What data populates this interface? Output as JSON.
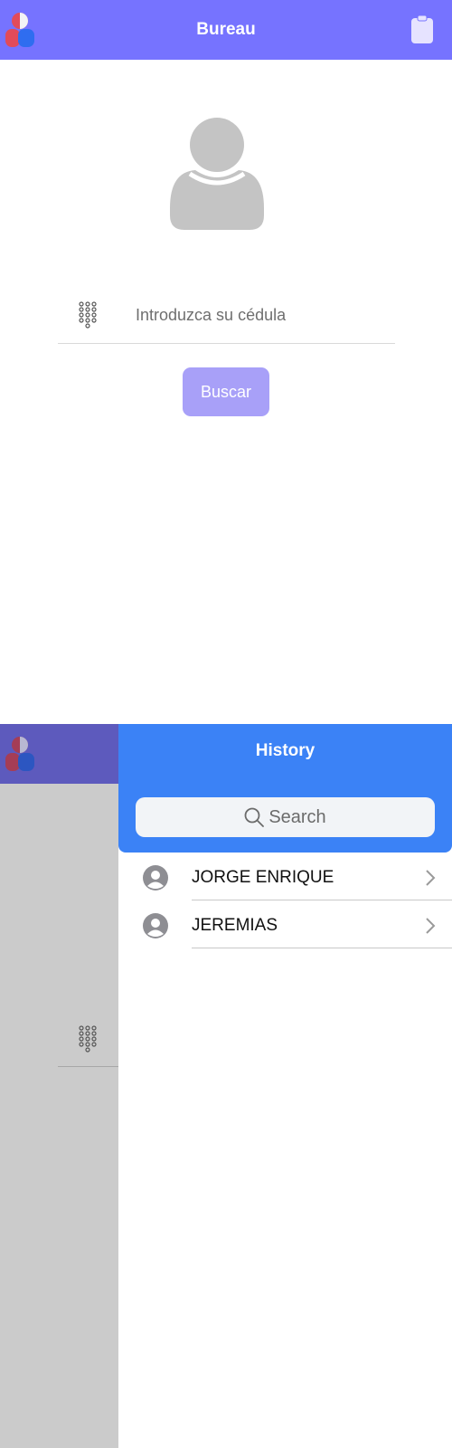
{
  "screen1": {
    "appbar": {
      "title": "Bureau",
      "logo_icon": "app-logo-icon",
      "action_icon": "clipboard-icon",
      "color": "#7673ff"
    },
    "avatar_icon": "user-silhouette-icon",
    "search": {
      "icon": "keypad-icon",
      "placeholder": "Introduzca su cédula",
      "value": ""
    },
    "button": {
      "label": "Buscar",
      "color": "#a8a0f8"
    }
  },
  "screen2": {
    "drawer": {
      "title": "History",
      "header_color": "#3b82f6",
      "search_placeholder": "Search",
      "items": [
        {
          "name": "JORGE ENRIQUE",
          "icon": "account-circle-icon"
        },
        {
          "name": "JEREMIAS",
          "icon": "account-circle-icon"
        }
      ]
    },
    "overlay_color": "#cbcbcb"
  }
}
